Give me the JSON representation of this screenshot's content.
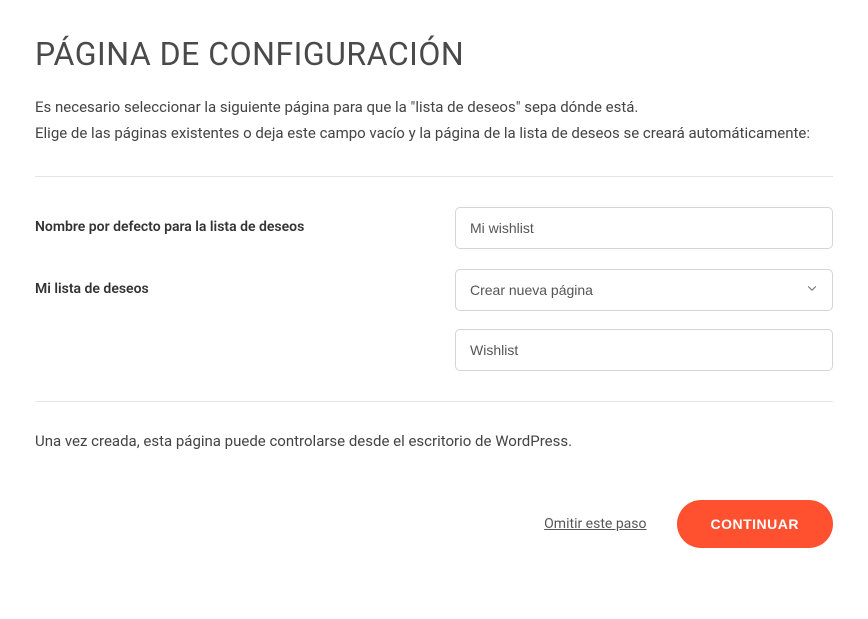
{
  "title": "PÁGINA DE CONFIGURACIÓN",
  "description_line1": "Es necesario seleccionar la siguiente página para que la \"lista de deseos\" sepa dónde está.",
  "description_line2": "Elige de las páginas existentes o deja este campo vacío y la página de la lista de deseos se creará automáticamente:",
  "form": {
    "default_name_label": "Nombre por defecto para la lista de deseos",
    "default_name_value": "Mi wishlist",
    "wishlist_page_label": "Mi lista de deseos",
    "wishlist_page_select": "Crear nueva página",
    "wishlist_page_name": "Wishlist"
  },
  "footer_text": "Una vez creada, esta página puede controlarse desde el escritorio de WordPress.",
  "actions": {
    "skip_label": "Omitir este paso",
    "continue_label": "CONTINUAR"
  }
}
